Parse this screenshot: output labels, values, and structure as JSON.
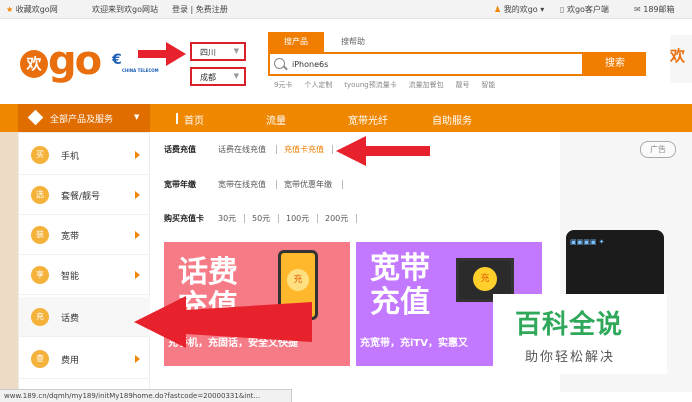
{
  "topbar": {
    "favorite": "收藏欢go网",
    "welcome": "欢迎来到欢go网站",
    "login_register": "登录 | 免费注册",
    "my_huango": "我的欢go",
    "client": "欢go客户端",
    "mail": "189邮箱"
  },
  "logo": {
    "huan": "欢",
    "go": "go"
  },
  "region": {
    "province": "四川",
    "city": "成都"
  },
  "search": {
    "tab_products": "搜产品",
    "tab_help": "搜帮助",
    "query": "iPhone6s",
    "button": "搜索",
    "hot_words": [
      "9元卡",
      "个人定制",
      "tyoung预流量卡",
      "流量加餐包",
      "靓号",
      "智能"
    ]
  },
  "nav": {
    "all_products": "全部产品及服务",
    "items": [
      "首页",
      "流量",
      "宽带光纤",
      "自助服务"
    ]
  },
  "sidebar": {
    "items": [
      {
        "badge": "买",
        "label": "手机"
      },
      {
        "badge": "选",
        "label": "套餐/靓号"
      },
      {
        "badge": "装",
        "label": "宽带"
      },
      {
        "badge": "享",
        "label": "智能"
      },
      {
        "badge": "充",
        "label": "话费"
      },
      {
        "badge": "查",
        "label": "费用"
      }
    ]
  },
  "panel": {
    "row1": {
      "title": "话费充值",
      "links": [
        "话费在线充值",
        "充值卡充值"
      ]
    },
    "row2": {
      "title": "宽带年缴",
      "links": [
        "宽带在线充值",
        "宽带优惠年缴"
      ]
    },
    "row3": {
      "title": "购买充值卡",
      "links": [
        "30元",
        "50元",
        "100元",
        "200元"
      ]
    },
    "banner1": {
      "line1": "话费",
      "line2": "充值",
      "coin": "充",
      "sub": "充手机，充固话，安全又快捷"
    },
    "banner2": {
      "line1": "宽带",
      "line2": "充值",
      "coin": "充",
      "sub": "充宽带，充iTV，实惠又"
    }
  },
  "ad": {
    "label": "广告"
  },
  "watermark": {
    "title": "百科全说",
    "subtitle": "助你轻松解决"
  },
  "status_url": "www.189.cn/dqmh/my189/initMy189home.do?fastcode=20000331&int...",
  "colors": {
    "orange": "#f08700",
    "red_arrow": "#e8222d",
    "banner1": "#f57b86",
    "banner2": "#c278ff"
  }
}
